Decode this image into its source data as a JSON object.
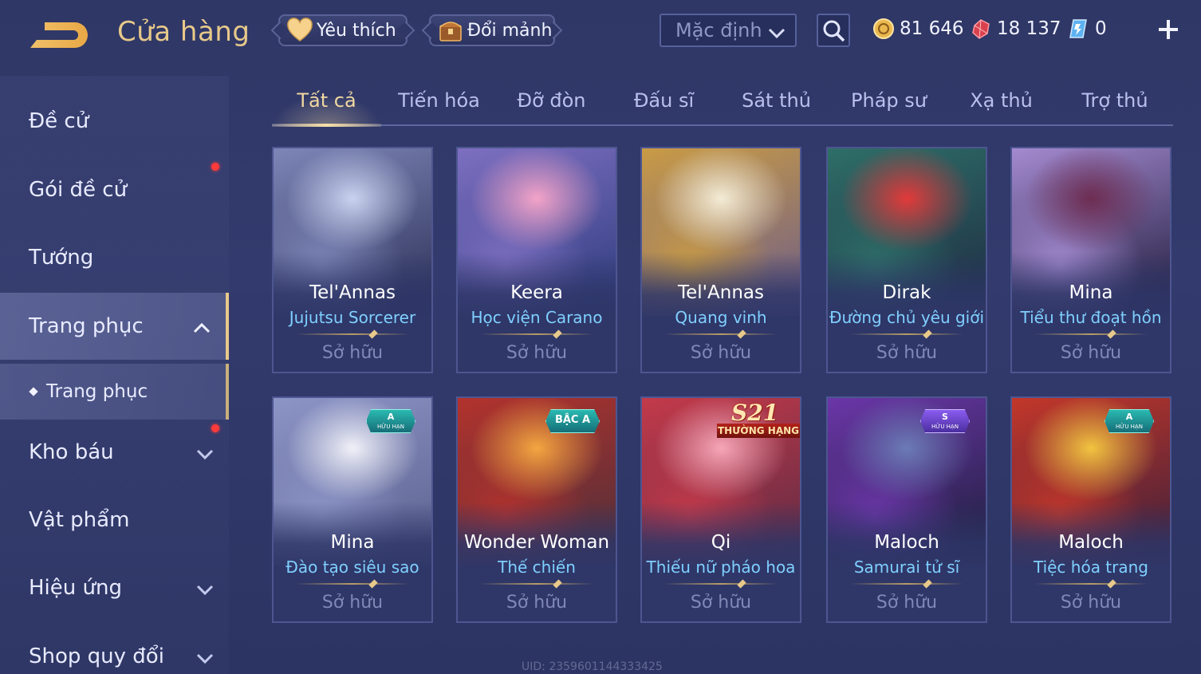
{
  "header": {
    "title": "Cửa hàng",
    "favorite_label": "Yêu thích",
    "shard_label": "Đổi mảnh",
    "sort": {
      "selected": "Mặc định"
    },
    "currencies": [
      {
        "icon": "gold-coin-icon",
        "value": "81 646"
      },
      {
        "icon": "ruby-gem-icon",
        "value": "18 137"
      },
      {
        "icon": "voucher-ticket-icon",
        "value": "0"
      }
    ]
  },
  "sidebar": {
    "items": [
      {
        "label": "Đề cử",
        "notify": false
      },
      {
        "label": "Gói đề cử",
        "notify": true
      },
      {
        "label": "Tướng",
        "notify": false
      },
      {
        "label": "Trang phục",
        "expanded": true
      },
      {
        "label": "Trang phục",
        "sub": true,
        "selected": true
      },
      {
        "label": "Kho báu",
        "notify": true
      },
      {
        "label": "Vật phẩm",
        "notify": false
      },
      {
        "label": "Hiệu ứng",
        "notify": false
      },
      {
        "label": "Shop quy đổi",
        "notify": false
      }
    ]
  },
  "tabs": [
    "Tất cả",
    "Tiến hóa",
    "Đỡ đòn",
    "Đấu sĩ",
    "Sát thủ",
    "Pháp sư",
    "Xạ thủ",
    "Trợ thủ"
  ],
  "active_tab": "Tất cả",
  "cards": [
    {
      "hero": "Tel'Annas",
      "skin": "Jujutsu Sorcerer",
      "status": "Sở hữu",
      "palette": [
        "#c9d3ef",
        "#7d86b8",
        "#2b2f55"
      ]
    },
    {
      "hero": "Keera",
      "skin": "Học viện Carano",
      "status": "Sở hữu",
      "palette": [
        "#f3a3c8",
        "#7d6fc1",
        "#2d3b7c"
      ]
    },
    {
      "hero": "Tel'Annas",
      "skin": "Quang vinh",
      "status": "Sở hữu",
      "palette": [
        "#f4ecd6",
        "#c99b45",
        "#6a5b8a"
      ]
    },
    {
      "hero": "Dirak",
      "skin": "Đường chủ yêu giới",
      "status": "Sở hữu",
      "palette": [
        "#e23a3a",
        "#2e6e68",
        "#1e2b42"
      ]
    },
    {
      "hero": "Mina",
      "skin": "Tiểu thư đoạt hồn",
      "status": "Sở hữu",
      "palette": [
        "#6e2d52",
        "#a48ad0",
        "#1d1a3a"
      ]
    },
    {
      "hero": "Mina",
      "skin": "Đào tạo siêu sao",
      "status": "Sở hữu",
      "badge": {
        "top": "A",
        "bottom": "HỮU HẠN"
      },
      "palette": [
        "#f0f1f8",
        "#8c95c7",
        "#5b5f8c"
      ]
    },
    {
      "hero": "Wonder Woman",
      "skin": "Thế chiến",
      "status": "Sở hữu",
      "badge": {
        "top": "BẬC A"
      },
      "palette": [
        "#f4a640",
        "#b3322d",
        "#4a2f3a"
      ]
    },
    {
      "hero": "Qi",
      "skin": "Thiếu nữ pháo hoa",
      "status": "Sở hữu",
      "emblem": {
        "top": "S21",
        "bottom": "THƯỜNG HẠNG"
      },
      "palette": [
        "#f6a6b8",
        "#c33a4a",
        "#5c2a44"
      ]
    },
    {
      "hero": "Maloch",
      "skin": "Samurai tử sĩ",
      "status": "Sở hữu",
      "badge": {
        "top": "S",
        "bottom": "HỮU HẠN"
      },
      "palette": [
        "#6b7bb6",
        "#6b36a8",
        "#1b1e38"
      ]
    },
    {
      "hero": "Maloch",
      "skin": "Tiệc hóa trang",
      "status": "Sở hữu",
      "badge": {
        "top": "A",
        "bottom": "HỮU HẠN"
      },
      "palette": [
        "#f2c440",
        "#c3372a",
        "#3a1e3a"
      ]
    }
  ],
  "footer": {
    "uid": "UID: 2359601144333425"
  },
  "colors": {
    "accent_gold": "#e7c98a",
    "skin_name": "#7fd0ff",
    "background": "#2f3766",
    "notify": "#ff3b3b"
  }
}
